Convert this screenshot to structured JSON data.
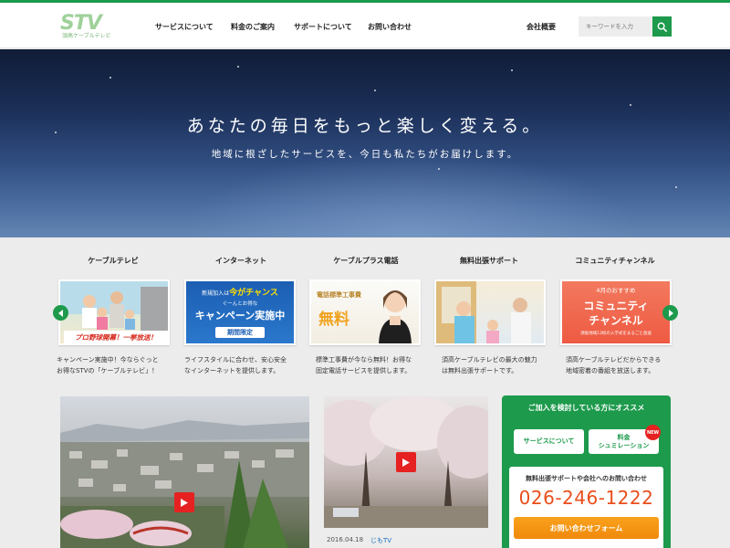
{
  "header": {
    "logo_text": "STV",
    "logo_sub": "須高ケーブルテレビ",
    "nav": [
      {
        "label": "サービスについて"
      },
      {
        "label": "料金のご案内"
      },
      {
        "label": "サポートについて"
      },
      {
        "label": "お問い合わせ"
      }
    ],
    "company_label": "会社概要",
    "search_placeholder": "キーワードを入力"
  },
  "hero": {
    "title": "あなたの毎日をもっと楽しく変える。",
    "subtitle": "地域に根ざしたサービスを、今日も私たちがお届けします。"
  },
  "services": [
    {
      "title": "ケーブルテレビ",
      "banner": "プロ野球開幕！一挙放送！",
      "desc_1": "キャンペーン実施中！今ならぐっと",
      "desc_2": "お得なSTVの「ケーブルテレビ」！"
    },
    {
      "title": "インターネット",
      "banner_top": "新規加入は",
      "banner_accent": "今がチャンス",
      "banner_mid": "ぐーんとお得な",
      "banner_main": "キャンペーン実施中",
      "banner_tag": "期間限定",
      "desc_1": "ライフスタイルに合わせ、安心安全",
      "desc_2": "なインターネットを提供します。"
    },
    {
      "title": "ケーブルプラス電話",
      "banner_top": "電話標準工事費",
      "banner_main": "無料",
      "desc_1": "標準工事費が今なら無料！お得な",
      "desc_2": "固定電話サービスを提供します。"
    },
    {
      "title": "無料出張サポート",
      "desc_1": "須高ケーブルテレビの最大の魅力",
      "desc_2": "は無料出張サポートです。"
    },
    {
      "title": "コミュニティチャンネル",
      "banner_top": "4月のおすすめ",
      "banner_main_1": "コミュニティ",
      "banner_main_2": "チャンネル",
      "banner_small": "須坂地域13校の入学式をまるごと放送",
      "desc_1": "須高ケーブルテレビだからできる",
      "desc_2": "地域密着の番組を放送します。"
    }
  ],
  "news": {
    "date": "2016.04.18",
    "category": "じもTV"
  },
  "promo": {
    "heading": "ご加入を検討している方にオススメ",
    "btn_service": "サービスについて",
    "btn_price_1": "料金",
    "btn_price_2": "シュミレーション",
    "new_badge": "NEW",
    "contact": "無料出張サポートや会社へのお問い合わせ",
    "phone": "026-246-1222",
    "form_label": "お問い合わせフォーム"
  },
  "colors": {
    "brand_green": "#1d9a4c",
    "accent_orange": "#f08a0c",
    "phone_orange": "#e84e1b",
    "play_red": "#e52221"
  }
}
